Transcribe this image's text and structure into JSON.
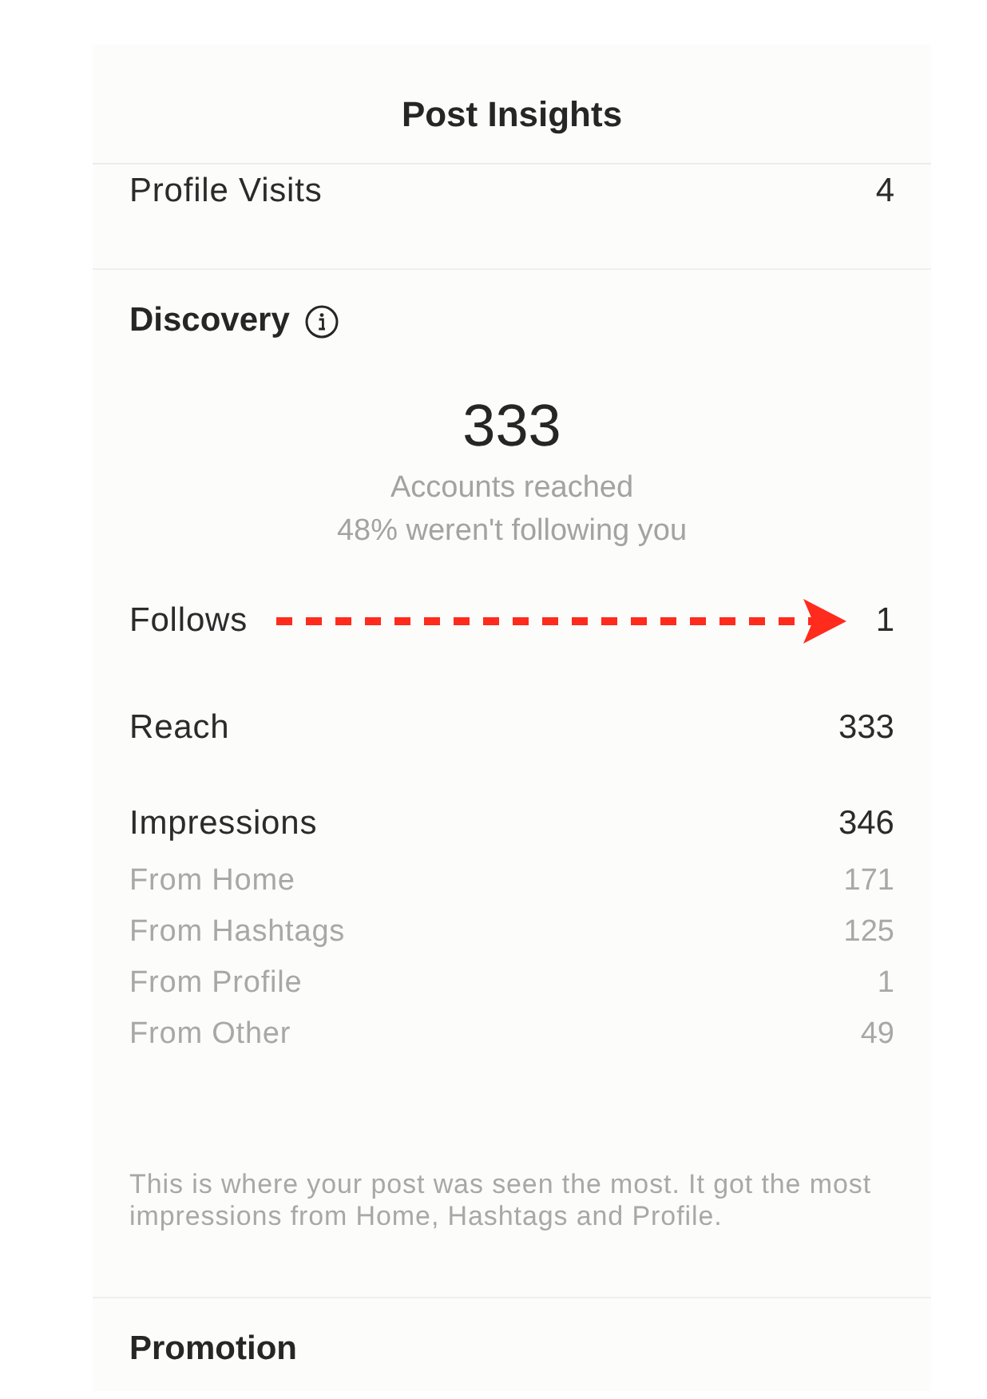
{
  "header": {
    "title": "Post Insights"
  },
  "activity": {
    "rows": [
      {
        "label": "Profile Visits",
        "value": "4"
      }
    ]
  },
  "discovery": {
    "title": "Discovery",
    "summary": {
      "value": "333",
      "label": "Accounts reached",
      "sublabel": "48% weren't following you"
    },
    "metrics": [
      {
        "label": "Follows",
        "value": "1",
        "annotated": true
      },
      {
        "label": "Reach",
        "value": "333",
        "annotated": false
      },
      {
        "label": "Impressions",
        "value": "346",
        "annotated": false,
        "children": [
          {
            "label": "From Home",
            "value": "171"
          },
          {
            "label": "From Hashtags",
            "value": "125"
          },
          {
            "label": "From Profile",
            "value": "1"
          },
          {
            "label": "From Other",
            "value": "49"
          }
        ]
      }
    ],
    "note": "This is where your post was seen the most. It got the most impressions from Home, Hashtags and Profile."
  },
  "promotion": {
    "title": "Promotion"
  }
}
